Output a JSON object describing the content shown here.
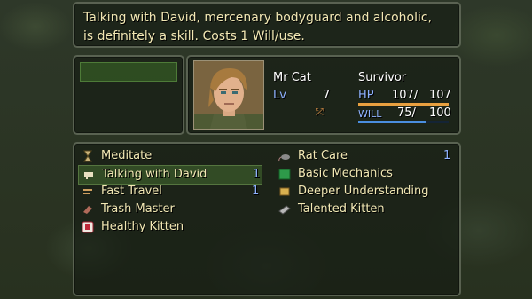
{
  "help": {
    "text": "Talking with David, mercenary bodyguard and alcoholic,\nis definitely a skill. Costs 1 Will/use."
  },
  "actor": {
    "name": "Mr Cat",
    "class": "Survivor",
    "level_label": "Lv",
    "level": "7",
    "hp_label": "HP",
    "hp": "107/",
    "hp_max": "107",
    "will_label": "WILL",
    "will": "75/",
    "will_max": "100",
    "hp_fraction": 1.0,
    "will_fraction": 0.75
  },
  "skills": [
    {
      "label": "Meditate",
      "cost": "",
      "icon": "hourglass-icon"
    },
    {
      "label": "Rat Care",
      "cost": "1",
      "icon": "rat-icon"
    },
    {
      "label": "Talking with David",
      "cost": "1",
      "icon": "speech-icon"
    },
    {
      "label": "Basic Mechanics",
      "cost": "",
      "icon": "green-book-icon"
    },
    {
      "label": "Fast Travel",
      "cost": "1",
      "icon": "travel-icon"
    },
    {
      "label": "Deeper Understanding",
      "cost": "",
      "icon": "scroll-icon"
    },
    {
      "label": "Trash Master",
      "cost": "",
      "icon": "trash-icon"
    },
    {
      "label": "Talented Kitten",
      "cost": "",
      "icon": "grey-book-icon"
    },
    {
      "label": "Healthy Kitten",
      "cost": "",
      "icon": "heart-card-icon"
    }
  ],
  "colors": {
    "text": "#f2e8b4",
    "stat_label": "#8fb2ff",
    "hp_bar": "#e8a040",
    "will_bar": "#4a8ee0"
  }
}
